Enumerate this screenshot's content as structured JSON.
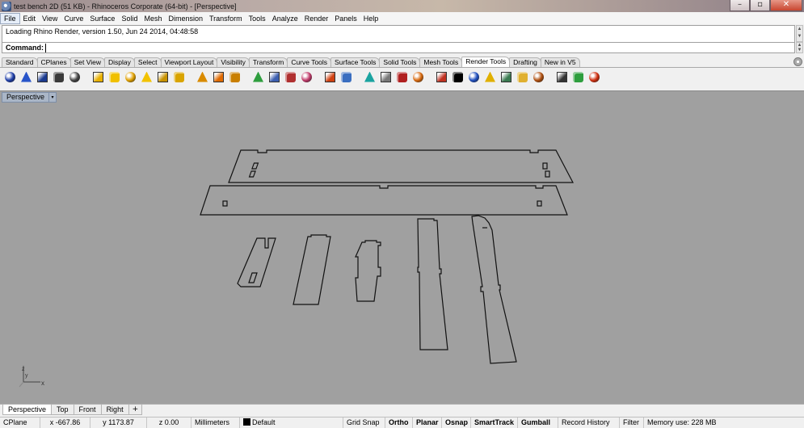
{
  "window": {
    "title": "test bench 2D (51 KB) - Rhinoceros Corporate (64-bit) - [Perspective]",
    "minimize_glyph": "–",
    "maximize_glyph": "▫",
    "close_glyph": "✕"
  },
  "menu": [
    "File",
    "Edit",
    "View",
    "Curve",
    "Surface",
    "Solid",
    "Mesh",
    "Dimension",
    "Transform",
    "Tools",
    "Analyze",
    "Render",
    "Panels",
    "Help"
  ],
  "command": {
    "history": "Loading Rhino Render, version 1.50, Jun 24 2014, 04:48:58",
    "label": "Command:",
    "value": ""
  },
  "toolbar_tabs": [
    {
      "label": "Standard",
      "active": false
    },
    {
      "label": "CPlanes",
      "active": false
    },
    {
      "label": "Set View",
      "active": false
    },
    {
      "label": "Display",
      "active": false
    },
    {
      "label": "Select",
      "active": false
    },
    {
      "label": "Viewport Layout",
      "active": false
    },
    {
      "label": "Visibility",
      "active": false
    },
    {
      "label": "Transform",
      "active": false
    },
    {
      "label": "Curve Tools",
      "active": false
    },
    {
      "label": "Surface Tools",
      "active": false
    },
    {
      "label": "Solid Tools",
      "active": false
    },
    {
      "label": "Mesh Tools",
      "active": false
    },
    {
      "label": "Render Tools",
      "active": true
    },
    {
      "label": "Drafting",
      "active": false
    },
    {
      "label": "New in V5",
      "active": false
    }
  ],
  "toolbar_icons": [
    {
      "name": "render-sphere-icon",
      "color": "#1f3fa8"
    },
    {
      "name": "render-preview-icon",
      "color": "#2855c9"
    },
    {
      "name": "render-window-icon",
      "color": "#1a3a8f"
    },
    {
      "name": "render-setup-icon",
      "color": "#3a3a3a"
    },
    {
      "name": "render-region-icon",
      "color": "#444"
    },
    {
      "name": "sep"
    },
    {
      "name": "spotlight-icon",
      "color": "#e8b000"
    },
    {
      "name": "point-light-icon",
      "color": "#f0c000"
    },
    {
      "name": "directional-light-icon",
      "color": "#e0a000"
    },
    {
      "name": "rectangular-light-icon",
      "color": "#f2c200"
    },
    {
      "name": "linear-light-icon",
      "color": "#c89200"
    },
    {
      "name": "light-properties-icon",
      "color": "#d9a400"
    },
    {
      "name": "sep"
    },
    {
      "name": "material-edit-icon",
      "color": "#d98b00"
    },
    {
      "name": "material-assign-icon",
      "color": "#e06a00"
    },
    {
      "name": "texture-mapping-icon",
      "color": "#c97f00"
    },
    {
      "name": "sep"
    },
    {
      "name": "environment-icon",
      "color": "#2e9e3e"
    },
    {
      "name": "sun-icon",
      "color": "#3c5fb0"
    },
    {
      "name": "decal-icon",
      "color": "#b03030"
    },
    {
      "name": "ground-plane-icon",
      "color": "#c03b6a"
    },
    {
      "name": "sep"
    },
    {
      "name": "material-editor-icon",
      "color": "#d04010"
    },
    {
      "name": "texture-palette-icon",
      "color": "#3a6ec0"
    },
    {
      "name": "sep"
    },
    {
      "name": "box-mapping-icon",
      "color": "#1aa3a0"
    },
    {
      "name": "curved-mapping-icon",
      "color": "#777"
    },
    {
      "name": "render-settings-icon",
      "color": "#b02020"
    },
    {
      "name": "basketball-icon",
      "color": "#d86a10"
    },
    {
      "name": "sep"
    },
    {
      "name": "edit-pen-icon",
      "color": "#c03020"
    },
    {
      "name": "checker-icon",
      "color": "#000"
    },
    {
      "name": "sphere-mapping-icon",
      "color": "#2050c0"
    },
    {
      "name": "spot-icon",
      "color": "#e0b000"
    },
    {
      "name": "folder-camera-icon",
      "color": "#3a7a50"
    },
    {
      "name": "folder-icon",
      "color": "#e0b030"
    },
    {
      "name": "gear-icon",
      "color": "#b05010"
    },
    {
      "name": "sep"
    },
    {
      "name": "filmstrip-icon",
      "color": "#333"
    },
    {
      "name": "play-icon",
      "color": "#2e9e3e"
    },
    {
      "name": "record-icon",
      "color": "#d03010"
    }
  ],
  "viewport": {
    "name": "Perspective",
    "menu_glyph": "▾",
    "axis_x": "x",
    "axis_y": "y",
    "axis_z": "z"
  },
  "viewport_tabs": [
    {
      "label": "Perspective",
      "active": true
    },
    {
      "label": "Top",
      "active": false
    },
    {
      "label": "Front",
      "active": false
    },
    {
      "label": "Right",
      "active": false
    },
    {
      "label": "+",
      "active": false
    }
  ],
  "status": {
    "cplane": "CPlane",
    "x": "x -667.86",
    "y": "y 1173.87",
    "z": "z 0.00",
    "units": "Millimeters",
    "layer": "Default",
    "grid_snap": "Grid Snap",
    "ortho": "Ortho",
    "planar": "Planar",
    "osnap": "Osnap",
    "smarttrack": "SmartTrack",
    "gumball": "Gumball",
    "record_history": "Record History",
    "filter": "Filter",
    "memory": "Memory use: 228 MB"
  }
}
